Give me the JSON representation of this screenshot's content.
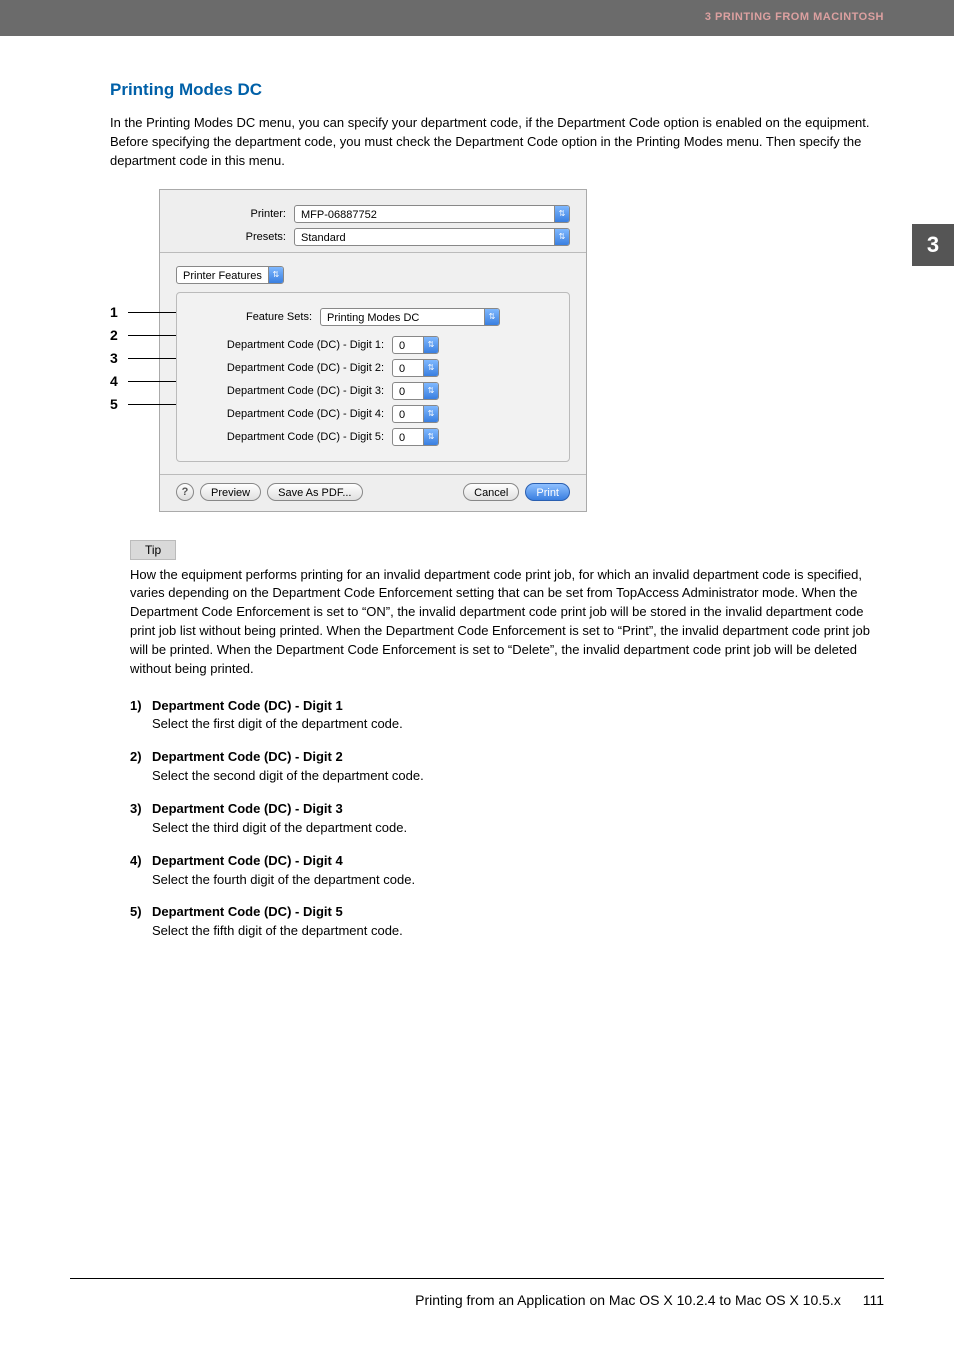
{
  "header": {
    "chapter": "3 PRINTING FROM MACINTOSH",
    "tab": "3"
  },
  "section": {
    "title": "Printing Modes DC",
    "intro": "In the Printing Modes DC menu, you can specify your department code, if the Department Code option is enabled on the equipment. Before specifying the department code, you must check the Department Code option in the Printing Modes menu. Then specify the department code in this menu."
  },
  "callouts": [
    "1",
    "2",
    "3",
    "4",
    "5"
  ],
  "dialog": {
    "printer_label": "Printer:",
    "printer_value": "MFP-06887752",
    "presets_label": "Presets:",
    "presets_value": "Standard",
    "panel_select": "Printer Features",
    "feature_sets_label": "Feature Sets:",
    "feature_sets_value": "Printing Modes DC",
    "digits": [
      {
        "label": "Department Code (DC) - Digit 1:",
        "value": "0"
      },
      {
        "label": "Department Code (DC) - Digit 2:",
        "value": "0"
      },
      {
        "label": "Department Code (DC) - Digit 3:",
        "value": "0"
      },
      {
        "label": "Department Code (DC) - Digit 4:",
        "value": "0"
      },
      {
        "label": "Department Code (DC) - Digit 5:",
        "value": "0"
      }
    ],
    "buttons": {
      "help": "?",
      "preview": "Preview",
      "save_pdf": "Save As PDF...",
      "cancel": "Cancel",
      "print": "Print"
    }
  },
  "tip": {
    "label": "Tip",
    "body": "How the equipment performs printing for an invalid department code print job, for which an invalid department code is specified, varies depending on the Department Code Enforcement setting that can be set from TopAccess Administrator mode. When the Department Code Enforcement is set to “ON”, the invalid department code print job will be stored in the invalid department code print job list without being printed. When the Department Code Enforcement is set to “Print”, the invalid department code print job will be printed. When the Department Code Enforcement is set to “Delete”, the invalid department code print job will be deleted without being printed."
  },
  "items": [
    {
      "num": "1)",
      "title": "Department Code (DC) - Digit 1",
      "desc": "Select the first digit of the department code."
    },
    {
      "num": "2)",
      "title": "Department Code (DC) - Digit 2",
      "desc": "Select the second digit of the department code."
    },
    {
      "num": "3)",
      "title": "Department Code (DC) - Digit 3",
      "desc": "Select the third digit of the department code."
    },
    {
      "num": "4)",
      "title": "Department Code (DC) - Digit 4",
      "desc": "Select the fourth digit of the department code."
    },
    {
      "num": "5)",
      "title": "Department Code (DC) - Digit 5",
      "desc": "Select the fifth digit of the department code."
    }
  ],
  "footer": {
    "text": "Printing from an Application on Mac OS X 10.2.4 to Mac OS X 10.5.x",
    "page": "111"
  }
}
